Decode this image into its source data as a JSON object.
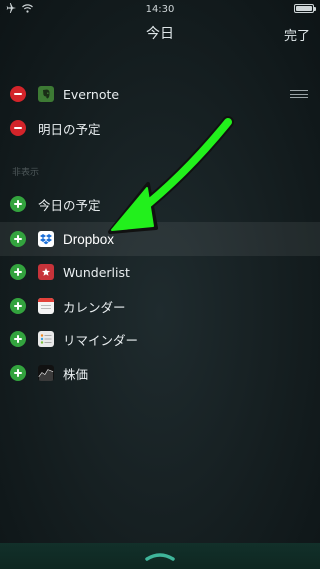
{
  "status_bar": {
    "time": "14:30"
  },
  "nav": {
    "title": "今日",
    "done_label": "完了"
  },
  "section_header": "非表示",
  "included_items": [
    {
      "label": "Evernote",
      "icon": "evernote-icon",
      "control": "remove",
      "reorder": true
    },
    {
      "label": "明日の予定",
      "icon": "",
      "control": "remove",
      "reorder": false
    }
  ],
  "available_items": [
    {
      "label": "今日の予定",
      "icon": "",
      "control": "add"
    },
    {
      "label": "Dropbox",
      "icon": "dropbox-icon",
      "control": "add",
      "highlighted": true
    },
    {
      "label": "Wunderlist",
      "icon": "wunderlist-icon",
      "control": "add"
    },
    {
      "label": "カレンダー",
      "icon": "calendar-icon",
      "control": "add"
    },
    {
      "label": "リマインダー",
      "icon": "reminders-icon",
      "control": "add"
    },
    {
      "label": "株価",
      "icon": "stocks-icon",
      "control": "add"
    }
  ],
  "colors": {
    "remove": "#d3242a",
    "add": "#33a33e",
    "annotation_arrow": "#22f01c"
  }
}
